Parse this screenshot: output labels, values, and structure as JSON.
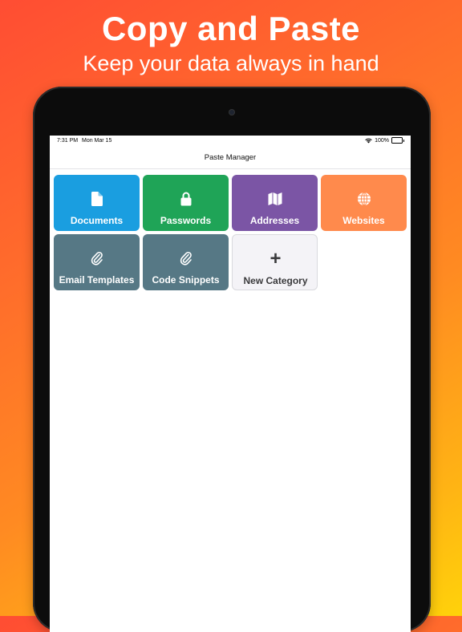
{
  "marketing": {
    "headline": "Copy and Paste",
    "subline": "Keep your data always in hand"
  },
  "status_bar": {
    "time": "7:31 PM",
    "date": "Mon Mar 15",
    "battery": "100%"
  },
  "nav": {
    "title": "Paste Manager"
  },
  "categories": [
    {
      "label": "Documents",
      "icon": "document-icon",
      "color": "#1a9ee0"
    },
    {
      "label": "Passwords",
      "icon": "lock-icon",
      "color": "#1fa457"
    },
    {
      "label": "Addresses",
      "icon": "map-icon",
      "color": "#7b55a5"
    },
    {
      "label": "Websites",
      "icon": "globe-icon",
      "color": "#ff8a4c"
    },
    {
      "label": "Email Templates",
      "icon": "paperclip-icon",
      "color": "#567885"
    },
    {
      "label": "Code Snippets",
      "icon": "paperclip-icon",
      "color": "#567885"
    }
  ],
  "new_category": {
    "label": "New Category",
    "icon": "plus-icon"
  }
}
